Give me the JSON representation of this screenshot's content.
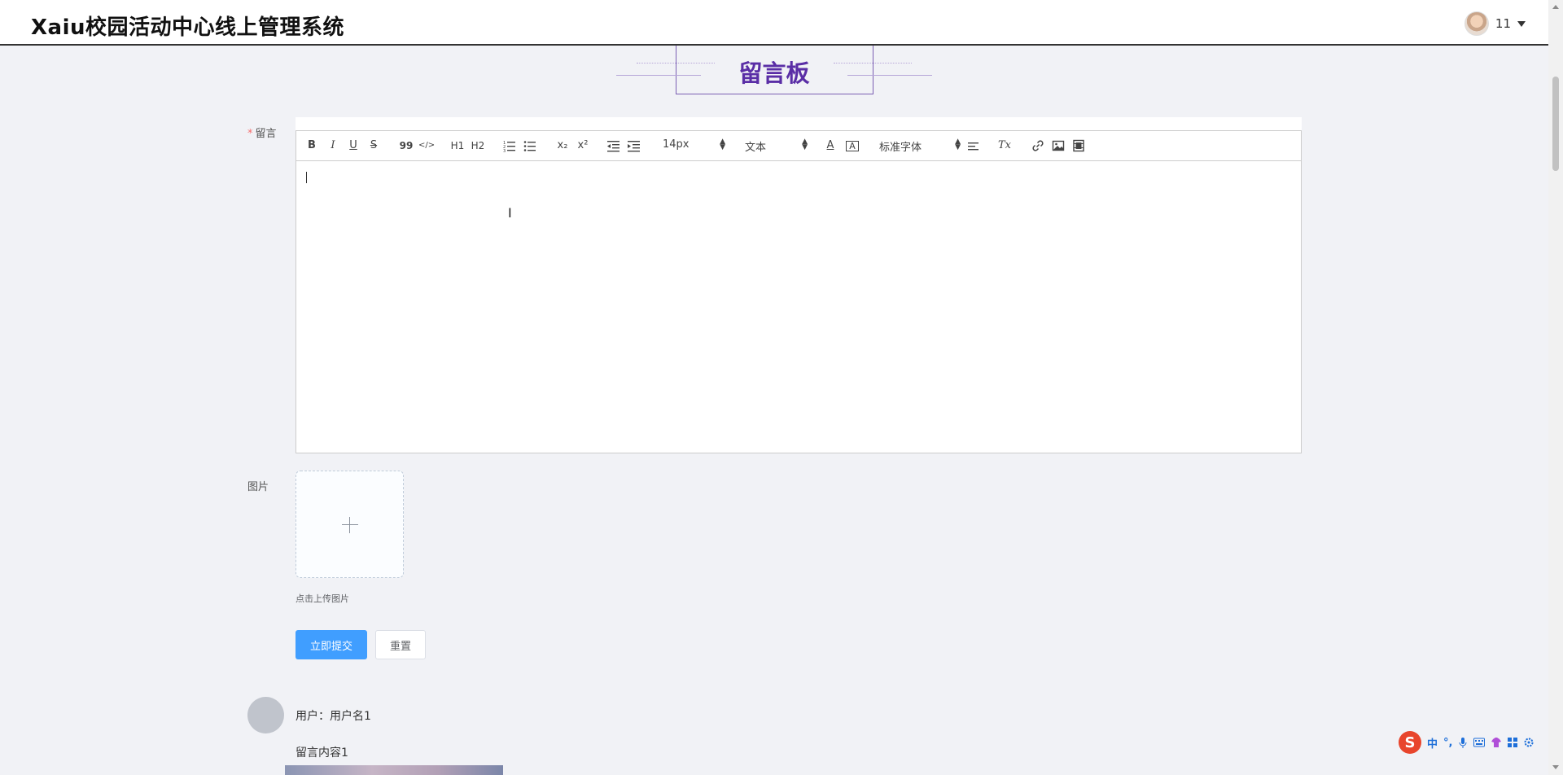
{
  "header": {
    "app_title": "Xaiu校园活动中心线上管理系统",
    "user_name": "11"
  },
  "board": {
    "title": "留言板"
  },
  "form": {
    "message_label": "留言",
    "required_mark": "*",
    "image_label": "图片",
    "upload_tip": "点击上传图片",
    "submit_label": "立即提交",
    "reset_label": "重置"
  },
  "toolbar": {
    "bold": "B",
    "italic": "I",
    "underline": "U",
    "strike": "S",
    "quote": "99",
    "code": "</>",
    "h1": "H1",
    "h2": "H2",
    "sub": "x₂",
    "sup": "x²",
    "size_value": "14px",
    "header_value": "文本",
    "font_value": "标准字体",
    "text_color": "A",
    "bg_color": "A",
    "clean": "Tx"
  },
  "comments": [
    {
      "user": "用户：用户名1",
      "content": "留言内容1"
    }
  ],
  "ime": {
    "lang": "中",
    "punct": "°,"
  }
}
